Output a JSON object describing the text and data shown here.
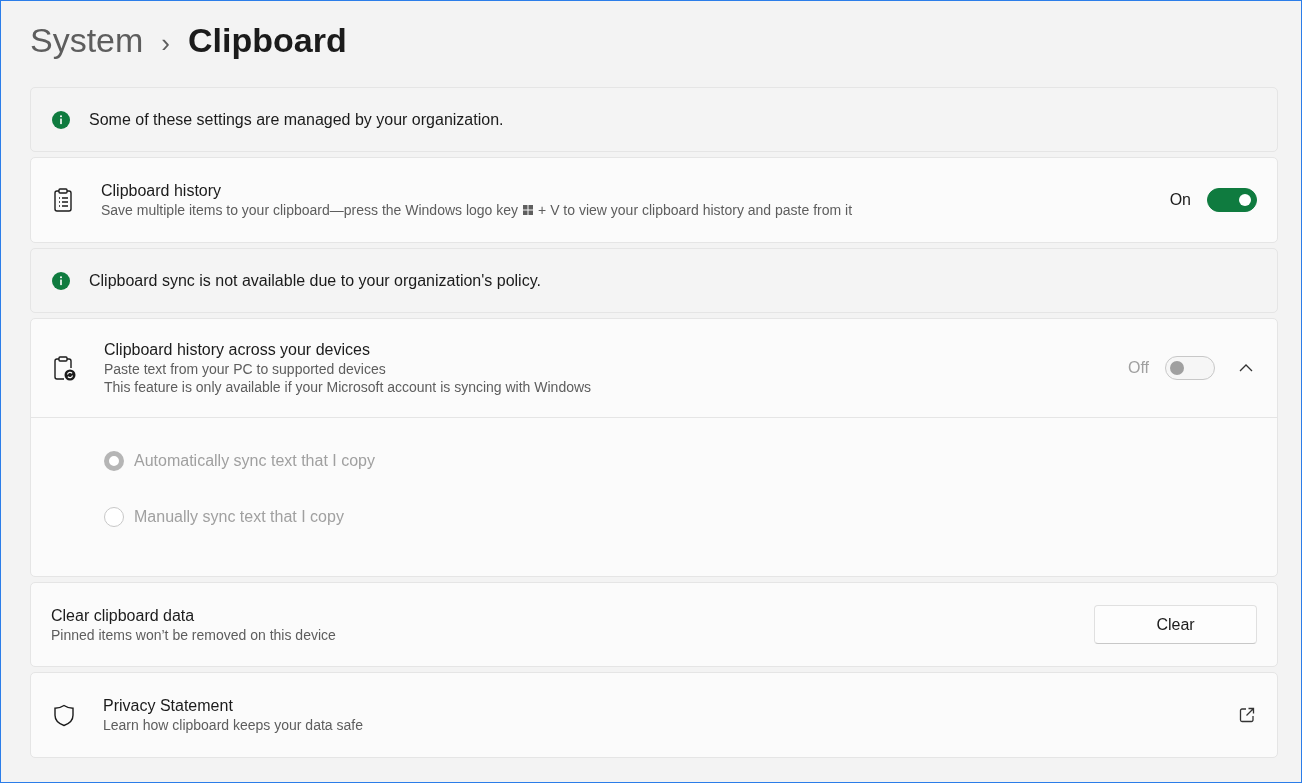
{
  "breadcrumb": {
    "parent": "System",
    "separator": "›",
    "current": "Clipboard"
  },
  "cards": [
    {
      "kind": "info",
      "text": "Some of these settings are managed by your organization."
    },
    {
      "kind": "toggle",
      "title": "Clipboard history",
      "description_before_key": "Save multiple items to your clipboard—press the Windows logo key",
      "description_after_key": "+ V to view your clipboard history and paste from it",
      "state_label": "On",
      "on": true,
      "disabled": false
    },
    {
      "kind": "info",
      "text": "Clipboard sync is not available due to your organization's policy."
    },
    {
      "kind": "expander",
      "title": "Clipboard history across your devices",
      "descriptions": [
        "Paste text from your PC to supported devices",
        "This feature is only available if your Microsoft account is syncing with Windows"
      ],
      "state_label": "Off",
      "on": false,
      "disabled": true,
      "expanded": true,
      "options": [
        {
          "label": "Automatically sync text that I copy",
          "selected": true,
          "disabled": true
        },
        {
          "label": "Manually sync text that I copy",
          "selected": false,
          "disabled": true
        }
      ]
    },
    {
      "kind": "button",
      "title": "Clear clipboard data",
      "description": "Pinned items won’t be removed on this device",
      "button": "Clear"
    },
    {
      "kind": "link",
      "title": "Privacy Statement",
      "description": "Learn how clipboard keeps your data safe"
    }
  ]
}
